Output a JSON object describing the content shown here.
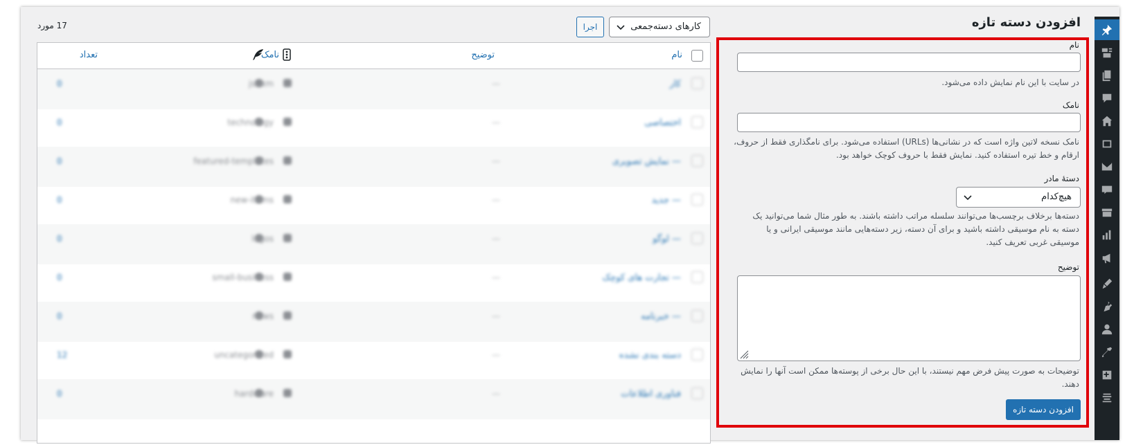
{
  "form": {
    "title": "افزودن دسته تازه",
    "name_label": "نام",
    "name_hint": "در سایت با این نام نمایش داده می‌شود.",
    "slug_label": "نامک",
    "slug_hint_line1": "نامک نسخه لاتین واژه است که در نشانی‌ها (URLs) استفاده می‌شود. برای نامگذاری فقط از حروف،",
    "slug_hint_line2": "ارقام و خط تیره استفاده کنید. نمایش فقط با حروف کوچک خواهد بود.",
    "parent_label": "دستهٔ مادر",
    "parent_value": "هیچ‌کدام",
    "parent_hint_line1": "دسته‌ها برخلاف برچسب‌ها می‌توانند سلسله مراتب داشته باشند. به طور مثال شما می‌توانید یک",
    "parent_hint_line2": "دسته به نام موسیقی داشته باشید و برای آن دسته، زیر دسته‌هایی مانند موسیقی ایرانی و یا",
    "parent_hint_line3": "موسیقی غربی تعریف کنید.",
    "description_label": "توضیح",
    "description_hint_line1": "توضیحات به صورت پیش فرض مهم نیستند، با این حال برخی از پوسته‌ها ممکن است آنها را نمایش",
    "description_hint_line2": "دهند.",
    "submit_label": "افزودن دسته تازه"
  },
  "list": {
    "bulk_actions_label": "کارهای دسته‌جمعی",
    "apply_label": "اجرا",
    "items_count": "17 مورد",
    "columns": {
      "name": "نام",
      "description": "توضیح",
      "slug": "نامک",
      "count": "تعداد"
    },
    "rows": [
      {
        "name": "کار",
        "slug": "jsnxm",
        "description": "—",
        "count": "0"
      },
      {
        "name": "اختصاصی",
        "slug": "technology",
        "description": "—",
        "count": "0"
      },
      {
        "name": "— نمایش تصویری",
        "slug": "featured-templates",
        "description": "—",
        "count": "0"
      },
      {
        "name": "— جدید",
        "slug": "new-items",
        "description": "—",
        "count": "0"
      },
      {
        "name": "— لوگو",
        "slug": "logos",
        "description": "—",
        "count": "0"
      },
      {
        "name": "— تجارت های کوچک",
        "slug": "small-business",
        "description": "—",
        "count": "0"
      },
      {
        "name": "— خبرنامه",
        "slug": "news",
        "description": "—",
        "count": "0"
      },
      {
        "name": "دسته بندی نشده",
        "slug": "uncategorized",
        "description": "—",
        "count": "12"
      },
      {
        "name": "فناوری اطلاعات",
        "slug": "hardware",
        "description": "—",
        "count": "0"
      }
    ]
  },
  "sidebar": {
    "icons": [
      "pin-icon",
      "media-icon",
      "pages-icon",
      "comments-icon",
      "home-icon",
      "portfolio-icon",
      "mail-icon",
      "woo-icon",
      "products-icon",
      "analytics-icon",
      "marketing-icon",
      "appearance-icon",
      "plugins-icon",
      "users-icon",
      "tools-icon",
      "settings-icon",
      "seo-icon"
    ]
  },
  "colors": {
    "accent": "#2271b1",
    "highlight_border": "#e0000a",
    "sidebar_bg": "#1d2327"
  }
}
